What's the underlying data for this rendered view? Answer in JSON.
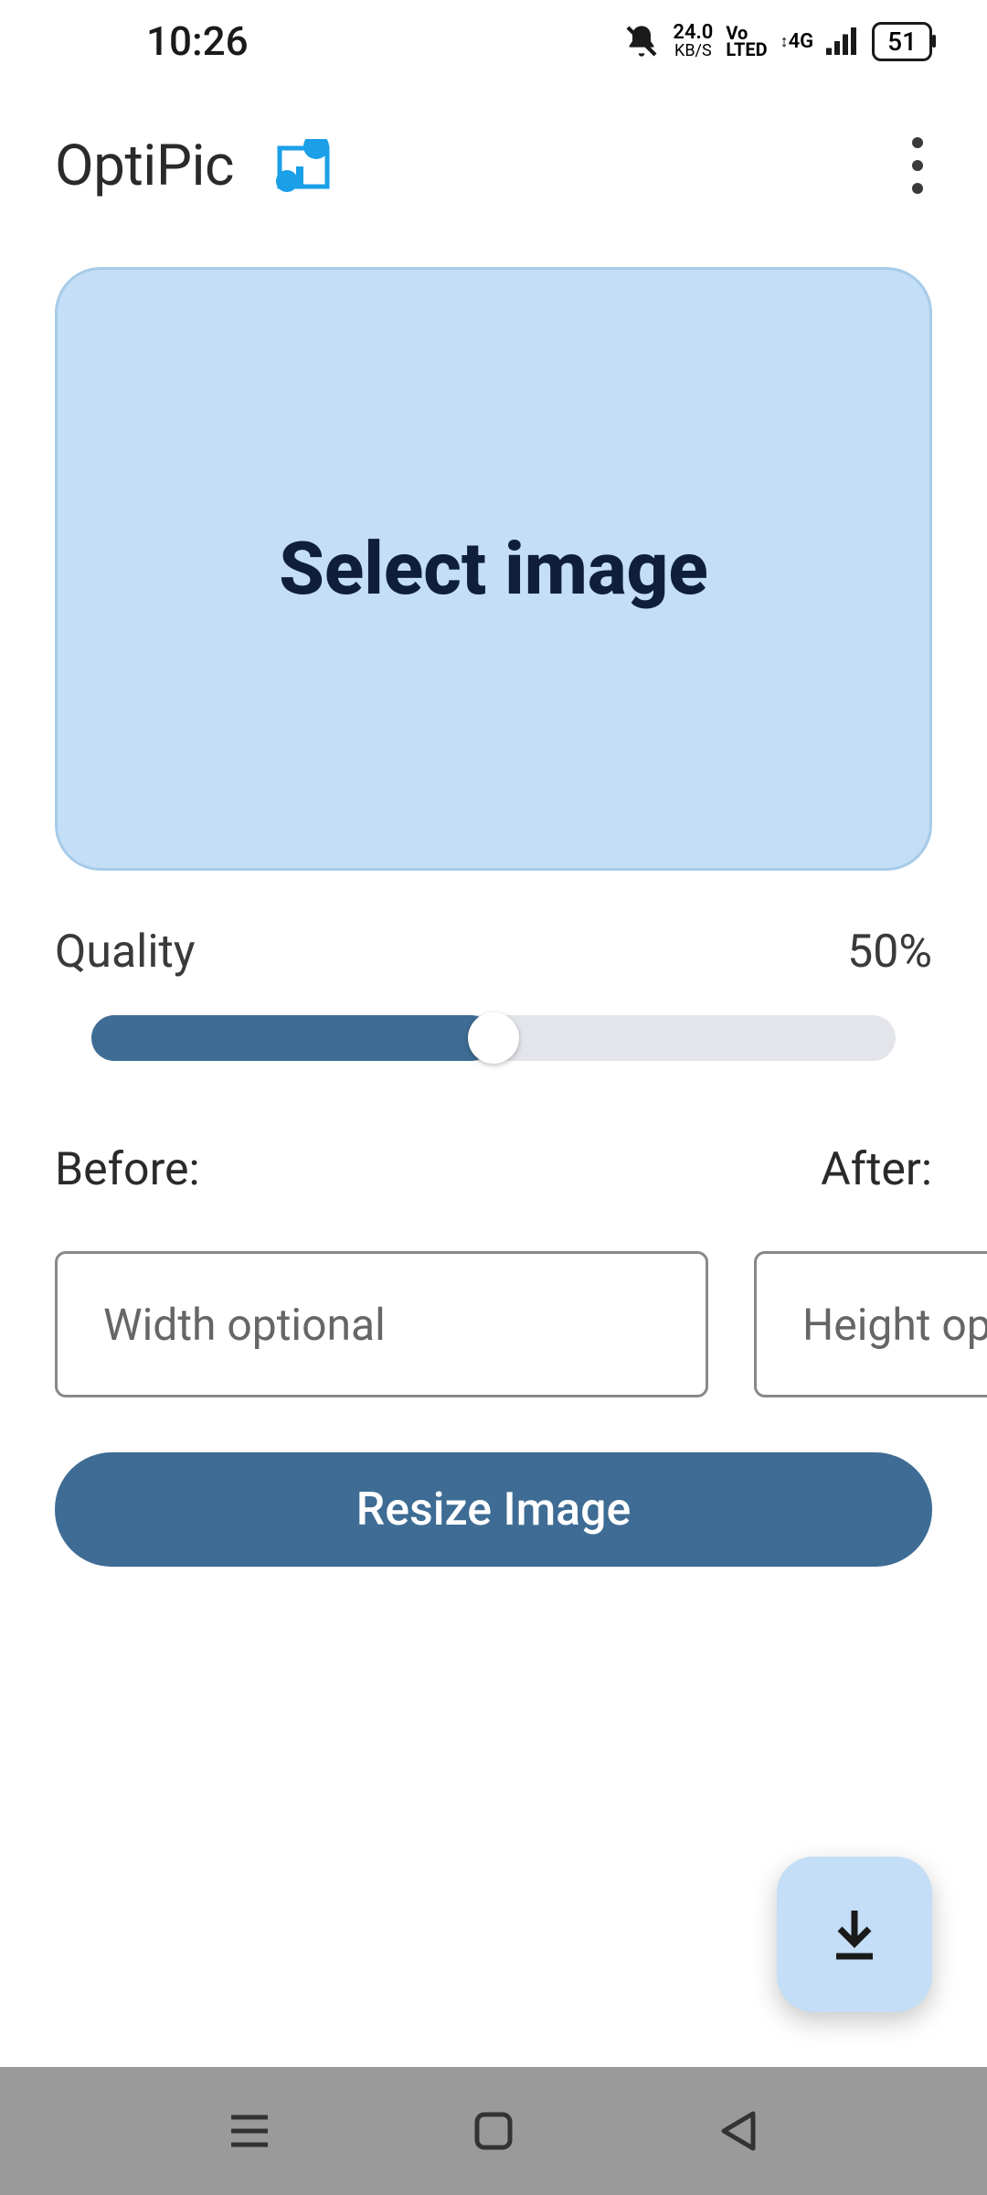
{
  "status": {
    "time": "10:26",
    "kbps_top": "24.0",
    "kbps_bot": "KB/S",
    "volte_top": "Vo",
    "volte_bot": "LTED",
    "net_label": "4G",
    "battery": "51"
  },
  "header": {
    "title": "OptiPic"
  },
  "main": {
    "select_image": "Select image",
    "quality_label": "Quality",
    "quality_value": "50%",
    "quality_percent": 50,
    "before_label": "Before:",
    "after_label": "After:",
    "width_placeholder": "Width optional",
    "height_placeholder": "Height optional",
    "resize_button": "Resize Image"
  }
}
